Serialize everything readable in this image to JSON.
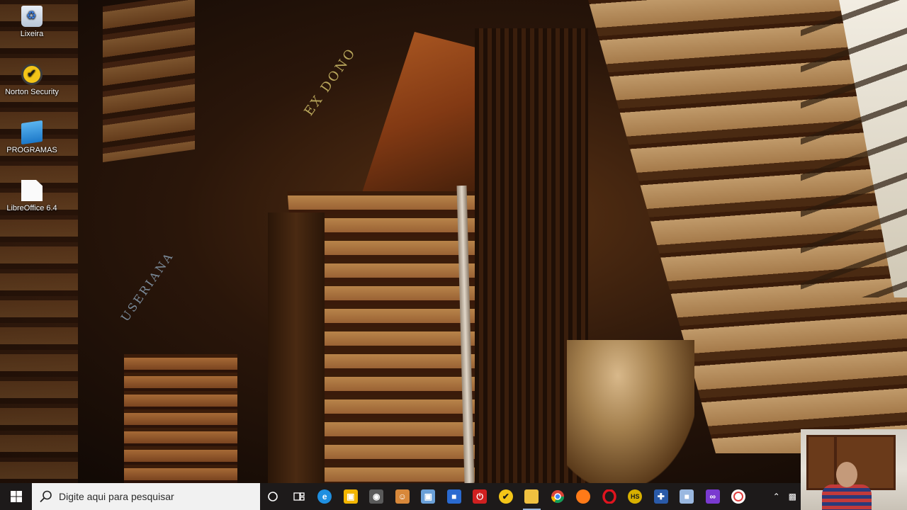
{
  "desktop": {
    "icons": [
      {
        "label": "Lixeira",
        "icon": "recycle-bin-icon"
      },
      {
        "label": "Norton Security",
        "icon": "norton-icon"
      },
      {
        "label": "PROGRAMAS",
        "icon": "monitor-icon"
      },
      {
        "label": "LibreOffice 6.4",
        "icon": "document-icon"
      }
    ],
    "wallpaper": {
      "engravings": [
        "EX DONO",
        "USERIANA"
      ]
    }
  },
  "taskbar": {
    "search_placeholder": "Digite aqui para pesquisar",
    "pinned": [
      {
        "icon": "cortana-circle-icon",
        "color": "#ffffff"
      },
      {
        "icon": "task-view-icon",
        "color": "#ffffff"
      },
      {
        "icon": "edge-icon",
        "color": "#1f8fe0"
      },
      {
        "icon": "store-icon",
        "color": "#f2b500"
      },
      {
        "icon": "app-gray-icon",
        "color": "#7a7a7a"
      },
      {
        "icon": "app-orange-icon",
        "color": "#d8883a"
      },
      {
        "icon": "app-photo-icon",
        "color": "#6aa0d8"
      },
      {
        "icon": "app-blue-icon",
        "color": "#2a6ad0"
      },
      {
        "icon": "power-red-icon",
        "color": "#d02020"
      },
      {
        "icon": "norton-taskbar-icon",
        "color": "#f3c518"
      },
      {
        "icon": "file-explorer-icon",
        "color": "#f0c040"
      },
      {
        "icon": "chrome-icon",
        "color": "#34a853"
      },
      {
        "icon": "firefox-icon",
        "color": "#ff7a18"
      },
      {
        "icon": "opera-icon",
        "color": "#e0141e"
      },
      {
        "icon": "hs-icon",
        "color": "#d8b000"
      },
      {
        "icon": "app-tool-icon",
        "color": "#2a5aa8"
      },
      {
        "icon": "cube-icon",
        "color": "#9ab8e0"
      },
      {
        "icon": "visual-studio-icon",
        "color": "#7a3ad0"
      },
      {
        "icon": "app-red-circle-icon",
        "color": "#e04040"
      }
    ],
    "hs_label": "HS"
  },
  "colors": {
    "taskbar_bg": "#1d1a1a",
    "search_bg": "#f1f1f1"
  }
}
